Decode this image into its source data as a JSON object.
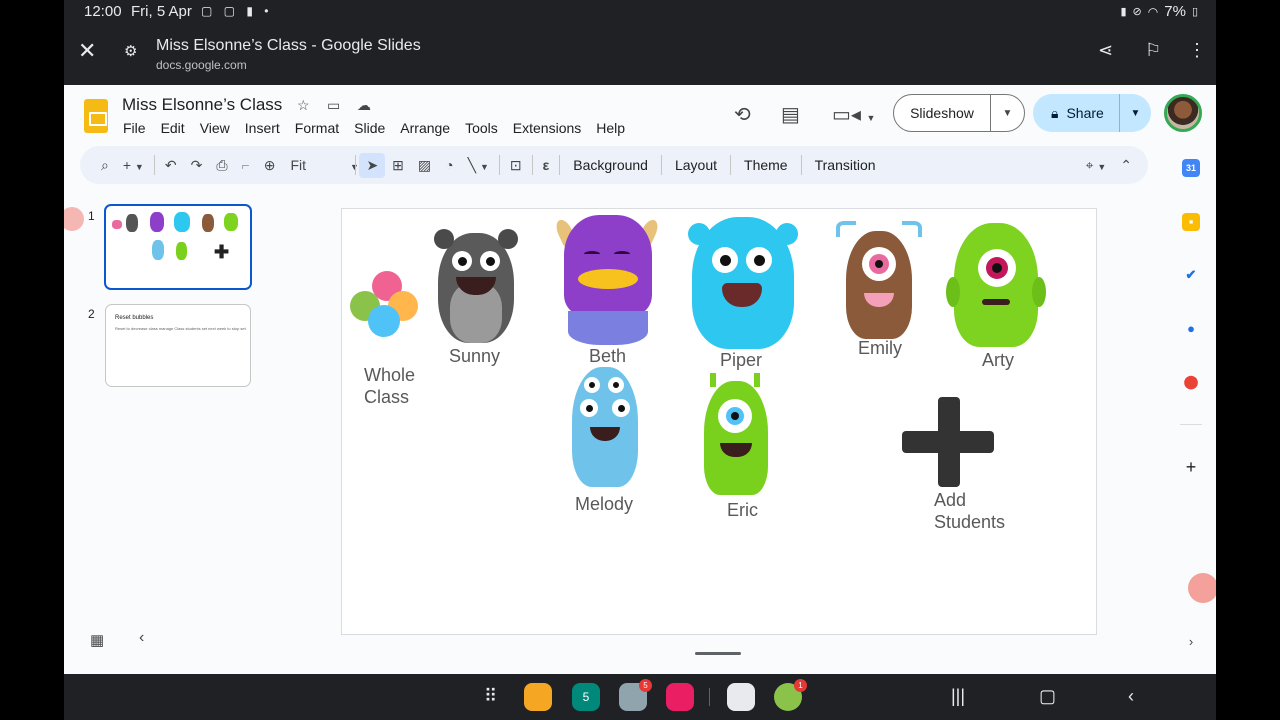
{
  "status": {
    "time": "12:00",
    "date": "Fri, 5 Apr",
    "battery": "7%"
  },
  "browser": {
    "title": "Miss Elsonne’s Class - Google Slides",
    "url": "docs.google.com"
  },
  "doc": {
    "title": "Miss Elsonne’s Class"
  },
  "menu": [
    "File",
    "Edit",
    "View",
    "Insert",
    "Format",
    "Slide",
    "Arrange",
    "Tools",
    "Extensions",
    "Help"
  ],
  "buttons": {
    "slideshow": "Slideshow",
    "share": "Share"
  },
  "toolbar": {
    "zoom": "Fit",
    "background": "Background",
    "layout": "Layout",
    "theme": "Theme",
    "transition": "Transition"
  },
  "thumbnails": [
    {
      "number": "1"
    },
    {
      "number": "2",
      "title": "Reset bubbles",
      "body": "Reset to decrease class manage Class students set next week to stop set"
    }
  ],
  "slide": {
    "whole_class": "Whole Class",
    "monsters": [
      "Sunny",
      "Beth",
      "Piper",
      "Emily",
      "Arty",
      "Melody",
      "Eric"
    ],
    "add_students": "Add Students"
  },
  "colors": {
    "sunny": "#5a5a5a",
    "beth": "#8e3fc9",
    "piper": "#2ec7ef",
    "emily": "#8a5a3a",
    "arty": "#7ed321",
    "melody": "#6fc3ea",
    "eric": "#79d11e",
    "accent": "#0b57d0",
    "share": "#c2e7ff"
  },
  "taskbar": {
    "badge_photos": "5",
    "badge_app": "1"
  }
}
